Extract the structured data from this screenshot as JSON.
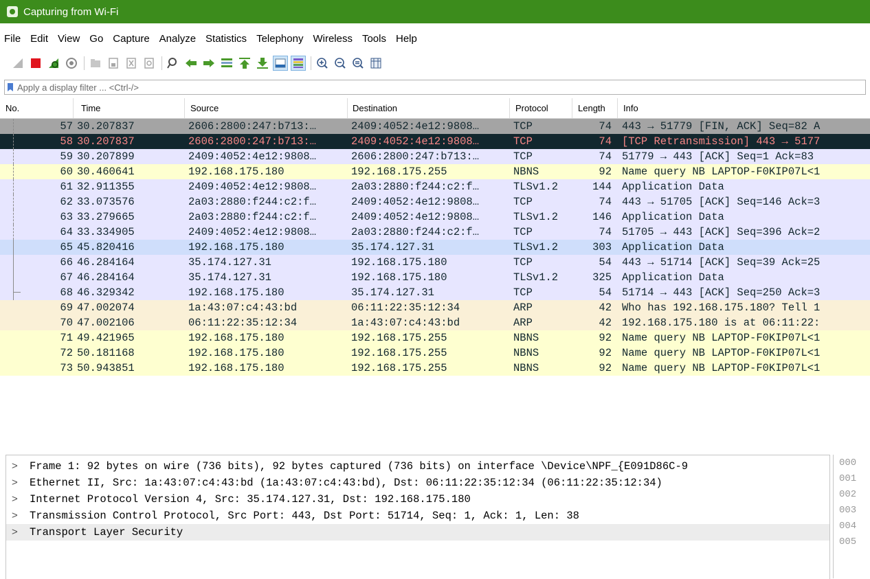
{
  "window": {
    "title": "Capturing from Wi-Fi"
  },
  "menu": [
    "File",
    "Edit",
    "View",
    "Go",
    "Capture",
    "Analyze",
    "Statistics",
    "Telephony",
    "Wireless",
    "Tools",
    "Help"
  ],
  "filter": {
    "placeholder": "Apply a display filter ... <Ctrl-/>",
    "value": ""
  },
  "columns": {
    "no": "No.",
    "time": "Time",
    "source": "Source",
    "destination": "Destination",
    "protocol": "Protocol",
    "length": "Length",
    "info": "Info"
  },
  "packets": [
    {
      "no": "57",
      "time": "30.207837",
      "src": "2606:2800:247:b713:…",
      "dst": "2409:4052:4e12:9808…",
      "proto": "TCP",
      "len": "74",
      "info": "443 → 51779 [FIN, ACK] Seq=82 A",
      "bg": "#a4a4a4",
      "fg": "#12272e"
    },
    {
      "no": "58",
      "time": "30.207837",
      "src": "2606:2800:247:b713:…",
      "dst": "2409:4052:4e12:9808…",
      "proto": "TCP",
      "len": "74",
      "info": "[TCP Retransmission] 443 → 5177",
      "bg": "#12272e",
      "fg": "#f78787"
    },
    {
      "no": "59",
      "time": "30.207899",
      "src": "2409:4052:4e12:9808…",
      "dst": "2606:2800:247:b713:…",
      "proto": "TCP",
      "len": "74",
      "info": "51779 → 443 [ACK] Seq=1 Ack=83",
      "bg": "#e7e6ff",
      "fg": "#12272e"
    },
    {
      "no": "60",
      "time": "30.460641",
      "src": "192.168.175.180",
      "dst": "192.168.175.255",
      "proto": "NBNS",
      "len": "92",
      "info": "Name query NB LAPTOP-F0KIP07L<1",
      "bg": "#feffd0",
      "fg": "#12272e"
    },
    {
      "no": "61",
      "time": "32.911355",
      "src": "2409:4052:4e12:9808…",
      "dst": "2a03:2880:f244:c2:f…",
      "proto": "TLSv1.2",
      "len": "144",
      "info": "Application Data",
      "bg": "#e7e6ff",
      "fg": "#12272e"
    },
    {
      "no": "62",
      "time": "33.073576",
      "src": "2a03:2880:f244:c2:f…",
      "dst": "2409:4052:4e12:9808…",
      "proto": "TCP",
      "len": "74",
      "info": "443 → 51705 [ACK] Seq=146 Ack=3",
      "bg": "#e7e6ff",
      "fg": "#12272e"
    },
    {
      "no": "63",
      "time": "33.279665",
      "src": "2a03:2880:f244:c2:f…",
      "dst": "2409:4052:4e12:9808…",
      "proto": "TLSv1.2",
      "len": "146",
      "info": "Application Data",
      "bg": "#e7e6ff",
      "fg": "#12272e"
    },
    {
      "no": "64",
      "time": "33.334905",
      "src": "2409:4052:4e12:9808…",
      "dst": "2a03:2880:f244:c2:f…",
      "proto": "TCP",
      "len": "74",
      "info": "51705 → 443 [ACK] Seq=396 Ack=2",
      "bg": "#e7e6ff",
      "fg": "#12272e"
    },
    {
      "no": "65",
      "time": "45.820416",
      "src": "192.168.175.180",
      "dst": "35.174.127.31",
      "proto": "TLSv1.2",
      "len": "303",
      "info": "Application Data",
      "bg": "#cfdefb",
      "fg": "#12272e"
    },
    {
      "no": "66",
      "time": "46.284164",
      "src": "35.174.127.31",
      "dst": "192.168.175.180",
      "proto": "TCP",
      "len": "54",
      "info": "443 → 51714 [ACK] Seq=39 Ack=25",
      "bg": "#e7e6ff",
      "fg": "#12272e"
    },
    {
      "no": "67",
      "time": "46.284164",
      "src": "35.174.127.31",
      "dst": "192.168.175.180",
      "proto": "TLSv1.2",
      "len": "325",
      "info": "Application Data",
      "bg": "#e7e6ff",
      "fg": "#12272e"
    },
    {
      "no": "68",
      "time": "46.329342",
      "src": "192.168.175.180",
      "dst": "35.174.127.31",
      "proto": "TCP",
      "len": "54",
      "info": "51714 → 443 [ACK] Seq=250 Ack=3",
      "bg": "#e7e6ff",
      "fg": "#12272e"
    },
    {
      "no": "69",
      "time": "47.002074",
      "src": "1a:43:07:c4:43:bd",
      "dst": "06:11:22:35:12:34",
      "proto": "ARP",
      "len": "42",
      "info": "Who has 192.168.175.180? Tell 1",
      "bg": "#faf0d7",
      "fg": "#12272e"
    },
    {
      "no": "70",
      "time": "47.002106",
      "src": "06:11:22:35:12:34",
      "dst": "1a:43:07:c4:43:bd",
      "proto": "ARP",
      "len": "42",
      "info": "192.168.175.180 is at 06:11:22:",
      "bg": "#faf0d7",
      "fg": "#12272e"
    },
    {
      "no": "71",
      "time": "49.421965",
      "src": "192.168.175.180",
      "dst": "192.168.175.255",
      "proto": "NBNS",
      "len": "92",
      "info": "Name query NB LAPTOP-F0KIP07L<1",
      "bg": "#feffd0",
      "fg": "#12272e"
    },
    {
      "no": "72",
      "time": "50.181168",
      "src": "192.168.175.180",
      "dst": "192.168.175.255",
      "proto": "NBNS",
      "len": "92",
      "info": "Name query NB LAPTOP-F0KIP07L<1",
      "bg": "#feffd0",
      "fg": "#12272e"
    },
    {
      "no": "73",
      "time": "50.943851",
      "src": "192.168.175.180",
      "dst": "192.168.175.255",
      "proto": "NBNS",
      "len": "92",
      "info": "Name query NB LAPTOP-F0KIP07L<1",
      "bg": "#feffd0",
      "fg": "#12272e"
    }
  ],
  "details": [
    "Frame 1: 92 bytes on wire (736 bits), 92 bytes captured (736 bits) on interface \\Device\\NPF_{E091D86C-9",
    "Ethernet II, Src: 1a:43:07:c4:43:bd (1a:43:07:c4:43:bd), Dst: 06:11:22:35:12:34 (06:11:22:35:12:34)",
    "Internet Protocol Version 4, Src: 35.174.127.31, Dst: 192.168.175.180",
    "Transmission Control Protocol, Src Port: 443, Dst Port: 51714, Seq: 1, Ack: 1, Len: 38",
    "Transport Layer Security"
  ],
  "hex_offsets": [
    "000",
    "001",
    "002",
    "003",
    "004",
    "005"
  ],
  "expand_glyph": ">",
  "toolbar_icons": [
    "shark-fin-start-icon",
    "stop-capture-icon",
    "restart-capture-icon",
    "capture-options-icon",
    "open-file-icon",
    "save-file-icon",
    "close-file-icon",
    "reload-file-icon",
    "find-packet-icon",
    "go-back-icon",
    "go-forward-icon",
    "go-to-packet-icon",
    "first-packet-icon",
    "last-packet-icon",
    "auto-scroll-icon",
    "colorize-icon",
    "zoom-in-icon",
    "zoom-out-icon",
    "normal-size-icon",
    "resize-columns-icon"
  ],
  "colors": {
    "titlebar": "#3c8c1c"
  }
}
